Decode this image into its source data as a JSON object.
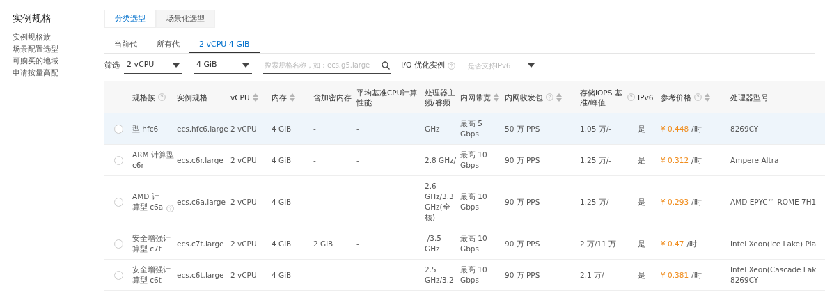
{
  "sidebar": {
    "title": "实例规格",
    "items": [
      "实例规格族",
      "场景配置选型",
      "可购买的地域",
      "申请按量高配"
    ]
  },
  "tabs": [
    {
      "label": "分类选型",
      "selected": true
    },
    {
      "label": "场景化选型",
      "selected": false
    }
  ],
  "subtabs": [
    {
      "label": "当前代",
      "selected": false
    },
    {
      "label": "所有代",
      "selected": false
    },
    {
      "label": "2 vCPU 4 GiB",
      "selected": true
    }
  ],
  "filter": {
    "label": "筛选",
    "selects": [
      "2 vCPU",
      "4 GiB"
    ],
    "search": {
      "placeholder": "搜索规格名称，如：ecs.g5.large"
    },
    "io_option": {
      "label": "I/O 优化实例"
    },
    "ipv6_select": {
      "placeholder": "是否支持IPv6"
    }
  },
  "table": {
    "columns": [
      {
        "label": "规格族",
        "sortable": false,
        "help": true,
        "kind": "name"
      },
      {
        "label": "实例规格",
        "sortable": false,
        "help": false,
        "kind": "text"
      },
      {
        "label": "vCPU",
        "sortable": true,
        "help": false,
        "kind": "text"
      },
      {
        "label": "内存",
        "sortable": true,
        "help": false,
        "kind": "text"
      },
      {
        "label": "含加密内存",
        "sortable": false,
        "help": false,
        "kind": "text"
      },
      {
        "label": "平均基准CPU计算性能",
        "sortable": false,
        "help": false,
        "kind": "text"
      },
      {
        "label": "处理器主频/睿频",
        "sortable": false,
        "help": false,
        "kind": "text"
      },
      {
        "label": "内网带宽",
        "sortable": true,
        "help": false,
        "kind": "text"
      },
      {
        "label": "内网收发包",
        "sortable": true,
        "help": true,
        "kind": "text"
      },
      {
        "label": "存储IOPS 基准/峰值",
        "sortable": false,
        "help": true,
        "kind": "text"
      },
      {
        "label": "IPv6",
        "sortable": false,
        "help": false,
        "kind": "text"
      },
      {
        "label": "参考价格",
        "sortable": true,
        "help": true,
        "kind": "price"
      },
      {
        "label": "处理器型号",
        "sortable": false,
        "help": false,
        "kind": "text"
      }
    ],
    "rows": [
      {
        "selected": false,
        "highlighted": true,
        "name_help": false,
        "cells": [
          "型 hfc6",
          "ecs.hfc6.large",
          "2 vCPU",
          "4 GiB",
          "-",
          "-",
          "GHz",
          "最高 5 Gbps",
          "50 万 PPS",
          "1.05 万/-",
          "是",
          {
            "amount": "¥ 0.448",
            "unit": "/时"
          },
          "8269CY"
        ]
      },
      {
        "selected": false,
        "highlighted": false,
        "name_help": false,
        "cells": [
          "ARM 计算型 c6r",
          "ecs.c6r.large",
          "2 vCPU",
          "4 GiB",
          "-",
          "-",
          "2.8 GHz/",
          "最高 10 Gbps",
          "90 万 PPS",
          "1.25 万/-",
          "是",
          {
            "amount": "¥ 0.312",
            "unit": "/时"
          },
          "Ampere Altra"
        ]
      },
      {
        "selected": false,
        "highlighted": false,
        "name_help": true,
        "cells": [
          "AMD 计算型 c6a",
          "ecs.c6a.large",
          "2 vCPU",
          "4 GiB",
          "-",
          "-",
          "2.6 GHz/3.3 GHz(全核)",
          "最高 10 Gbps",
          "90 万 PPS",
          "1.25 万/-",
          "是",
          {
            "amount": "¥ 0.293",
            "unit": "/时"
          },
          "AMD EPYC™ ROME 7H1"
        ]
      },
      {
        "selected": false,
        "highlighted": false,
        "name_help": false,
        "cells": [
          "安全增强计算型 c7t",
          "ecs.c7t.large",
          "2 vCPU",
          "4 GiB",
          "2 GiB",
          "-",
          "-/3.5 GHz",
          "最高 10 Gbps",
          "90 万 PPS",
          "2 万/11 万",
          "是",
          {
            "amount": "¥ 0.47",
            "unit": "/时"
          },
          "Intel Xeon(Ice Lake) Pla"
        ]
      },
      {
        "selected": false,
        "highlighted": false,
        "name_help": false,
        "cells": [
          "安全增强计算型 c6t",
          "ecs.c6t.large",
          "2 vCPU",
          "4 GiB",
          "-",
          "-",
          "2.5 GHz/3.2",
          "最高 10 Gbps",
          "90 万 PPS",
          "2.1 万/-",
          "是",
          {
            "amount": "¥ 0.381",
            "unit": "/时"
          },
          "Intel Xeon(Cascade Lak\n8269CY"
        ]
      }
    ]
  }
}
